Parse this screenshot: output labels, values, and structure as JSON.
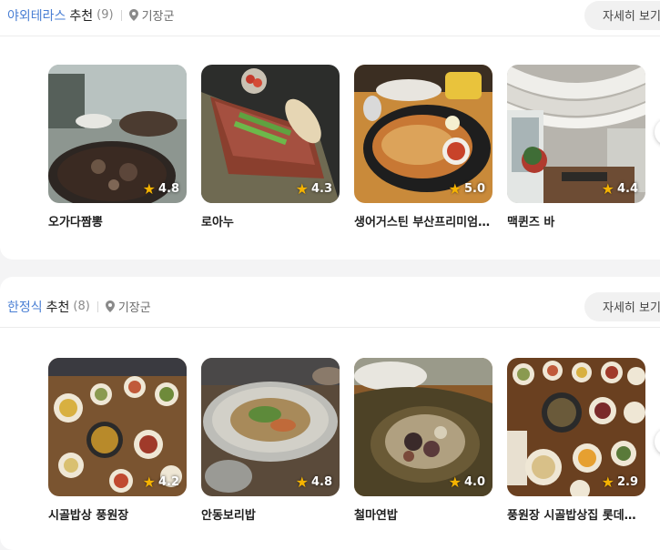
{
  "sections": [
    {
      "category": "야외테라스",
      "suffix": "추천",
      "count": "(9)",
      "location": "기장군",
      "more_label": "자세히 보기",
      "cards": [
        {
          "name": "오가다짬뽕",
          "rating": "4.8"
        },
        {
          "name": "로아누",
          "rating": "4.3"
        },
        {
          "name": "생어거스틴 부산프리미엄아울렛점",
          "rating": "5.0"
        },
        {
          "name": "맥퀸즈 바",
          "rating": "4.4"
        }
      ]
    },
    {
      "category": "한정식",
      "suffix": "추천",
      "count": "(8)",
      "location": "기장군",
      "more_label": "자세히 보기",
      "cards": [
        {
          "name": "시골밥상 풍원장",
          "rating": "4.2"
        },
        {
          "name": "안동보리밥",
          "rating": "4.8"
        },
        {
          "name": "철마연밥",
          "rating": "4.0"
        },
        {
          "name": "풍원장 시골밥상집 롯데몰점",
          "rating": "2.9"
        }
      ]
    }
  ],
  "icons": {
    "location": "location-pin-icon",
    "star": "star-icon",
    "next": "scroll-next-icon"
  },
  "colors": {
    "accent": "#4a7fd4",
    "star": "#f5b301"
  }
}
